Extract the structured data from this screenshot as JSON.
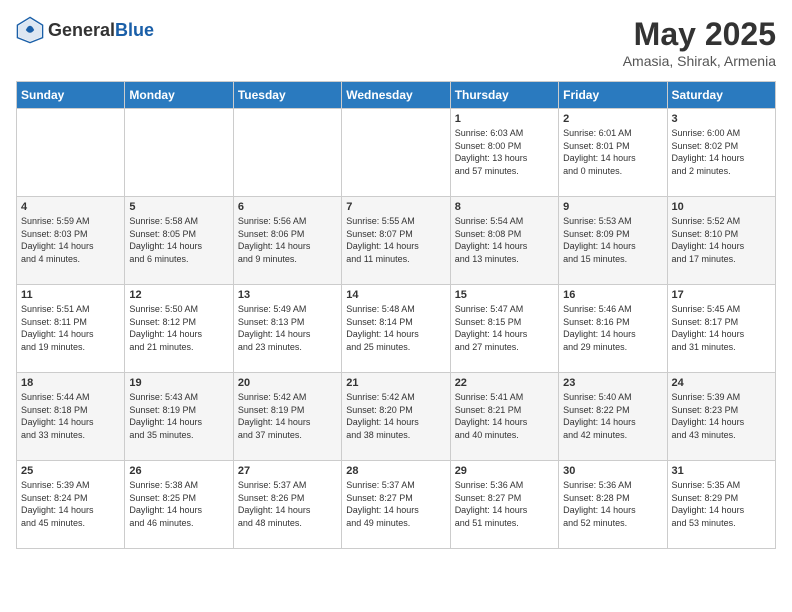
{
  "header": {
    "logo_general": "General",
    "logo_blue": "Blue",
    "month_title": "May 2025",
    "location": "Amasia, Shirak, Armenia"
  },
  "days_of_week": [
    "Sunday",
    "Monday",
    "Tuesday",
    "Wednesday",
    "Thursday",
    "Friday",
    "Saturday"
  ],
  "weeks": [
    [
      {
        "day": "",
        "info": ""
      },
      {
        "day": "",
        "info": ""
      },
      {
        "day": "",
        "info": ""
      },
      {
        "day": "",
        "info": ""
      },
      {
        "day": "1",
        "info": "Sunrise: 6:03 AM\nSunset: 8:00 PM\nDaylight: 13 hours\nand 57 minutes."
      },
      {
        "day": "2",
        "info": "Sunrise: 6:01 AM\nSunset: 8:01 PM\nDaylight: 14 hours\nand 0 minutes."
      },
      {
        "day": "3",
        "info": "Sunrise: 6:00 AM\nSunset: 8:02 PM\nDaylight: 14 hours\nand 2 minutes."
      }
    ],
    [
      {
        "day": "4",
        "info": "Sunrise: 5:59 AM\nSunset: 8:03 PM\nDaylight: 14 hours\nand 4 minutes."
      },
      {
        "day": "5",
        "info": "Sunrise: 5:58 AM\nSunset: 8:05 PM\nDaylight: 14 hours\nand 6 minutes."
      },
      {
        "day": "6",
        "info": "Sunrise: 5:56 AM\nSunset: 8:06 PM\nDaylight: 14 hours\nand 9 minutes."
      },
      {
        "day": "7",
        "info": "Sunrise: 5:55 AM\nSunset: 8:07 PM\nDaylight: 14 hours\nand 11 minutes."
      },
      {
        "day": "8",
        "info": "Sunrise: 5:54 AM\nSunset: 8:08 PM\nDaylight: 14 hours\nand 13 minutes."
      },
      {
        "day": "9",
        "info": "Sunrise: 5:53 AM\nSunset: 8:09 PM\nDaylight: 14 hours\nand 15 minutes."
      },
      {
        "day": "10",
        "info": "Sunrise: 5:52 AM\nSunset: 8:10 PM\nDaylight: 14 hours\nand 17 minutes."
      }
    ],
    [
      {
        "day": "11",
        "info": "Sunrise: 5:51 AM\nSunset: 8:11 PM\nDaylight: 14 hours\nand 19 minutes."
      },
      {
        "day": "12",
        "info": "Sunrise: 5:50 AM\nSunset: 8:12 PM\nDaylight: 14 hours\nand 21 minutes."
      },
      {
        "day": "13",
        "info": "Sunrise: 5:49 AM\nSunset: 8:13 PM\nDaylight: 14 hours\nand 23 minutes."
      },
      {
        "day": "14",
        "info": "Sunrise: 5:48 AM\nSunset: 8:14 PM\nDaylight: 14 hours\nand 25 minutes."
      },
      {
        "day": "15",
        "info": "Sunrise: 5:47 AM\nSunset: 8:15 PM\nDaylight: 14 hours\nand 27 minutes."
      },
      {
        "day": "16",
        "info": "Sunrise: 5:46 AM\nSunset: 8:16 PM\nDaylight: 14 hours\nand 29 minutes."
      },
      {
        "day": "17",
        "info": "Sunrise: 5:45 AM\nSunset: 8:17 PM\nDaylight: 14 hours\nand 31 minutes."
      }
    ],
    [
      {
        "day": "18",
        "info": "Sunrise: 5:44 AM\nSunset: 8:18 PM\nDaylight: 14 hours\nand 33 minutes."
      },
      {
        "day": "19",
        "info": "Sunrise: 5:43 AM\nSunset: 8:19 PM\nDaylight: 14 hours\nand 35 minutes."
      },
      {
        "day": "20",
        "info": "Sunrise: 5:42 AM\nSunset: 8:19 PM\nDaylight: 14 hours\nand 37 minutes."
      },
      {
        "day": "21",
        "info": "Sunrise: 5:42 AM\nSunset: 8:20 PM\nDaylight: 14 hours\nand 38 minutes."
      },
      {
        "day": "22",
        "info": "Sunrise: 5:41 AM\nSunset: 8:21 PM\nDaylight: 14 hours\nand 40 minutes."
      },
      {
        "day": "23",
        "info": "Sunrise: 5:40 AM\nSunset: 8:22 PM\nDaylight: 14 hours\nand 42 minutes."
      },
      {
        "day": "24",
        "info": "Sunrise: 5:39 AM\nSunset: 8:23 PM\nDaylight: 14 hours\nand 43 minutes."
      }
    ],
    [
      {
        "day": "25",
        "info": "Sunrise: 5:39 AM\nSunset: 8:24 PM\nDaylight: 14 hours\nand 45 minutes."
      },
      {
        "day": "26",
        "info": "Sunrise: 5:38 AM\nSunset: 8:25 PM\nDaylight: 14 hours\nand 46 minutes."
      },
      {
        "day": "27",
        "info": "Sunrise: 5:37 AM\nSunset: 8:26 PM\nDaylight: 14 hours\nand 48 minutes."
      },
      {
        "day": "28",
        "info": "Sunrise: 5:37 AM\nSunset: 8:27 PM\nDaylight: 14 hours\nand 49 minutes."
      },
      {
        "day": "29",
        "info": "Sunrise: 5:36 AM\nSunset: 8:27 PM\nDaylight: 14 hours\nand 51 minutes."
      },
      {
        "day": "30",
        "info": "Sunrise: 5:36 AM\nSunset: 8:28 PM\nDaylight: 14 hours\nand 52 minutes."
      },
      {
        "day": "31",
        "info": "Sunrise: 5:35 AM\nSunset: 8:29 PM\nDaylight: 14 hours\nand 53 minutes."
      }
    ]
  ]
}
